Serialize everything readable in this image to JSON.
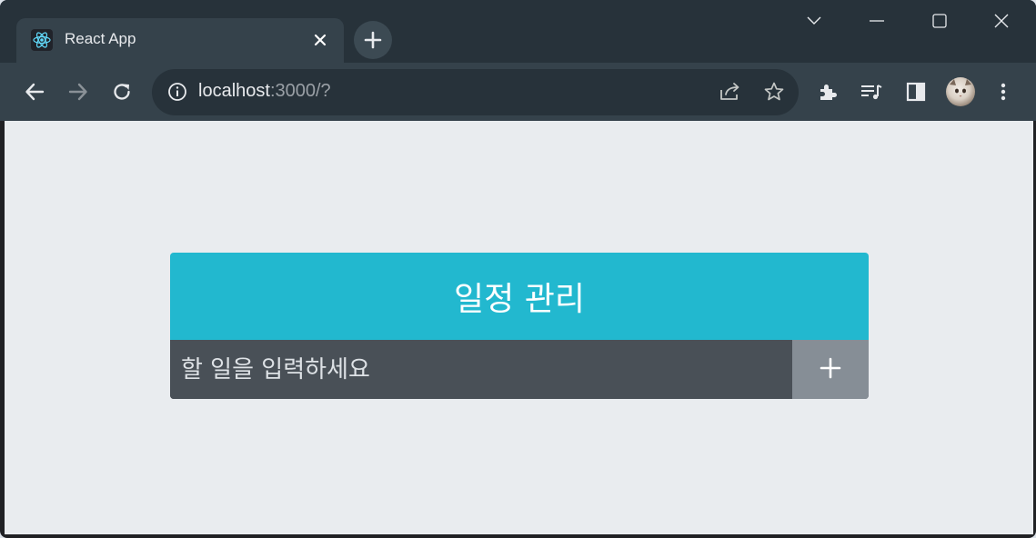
{
  "tab": {
    "title": "React App",
    "favicon": "react-logo-icon"
  },
  "address_bar": {
    "host": "localhost",
    "path": ":3000/?"
  },
  "todo": {
    "title": "일정 관리",
    "input_placeholder": "할 일을 입력하세요",
    "add_icon": "plus-icon"
  },
  "colors": {
    "header": "#22b8cf",
    "form_bg": "#495057",
    "button_bg": "#868e96",
    "page_bg": "#e9ecef"
  }
}
